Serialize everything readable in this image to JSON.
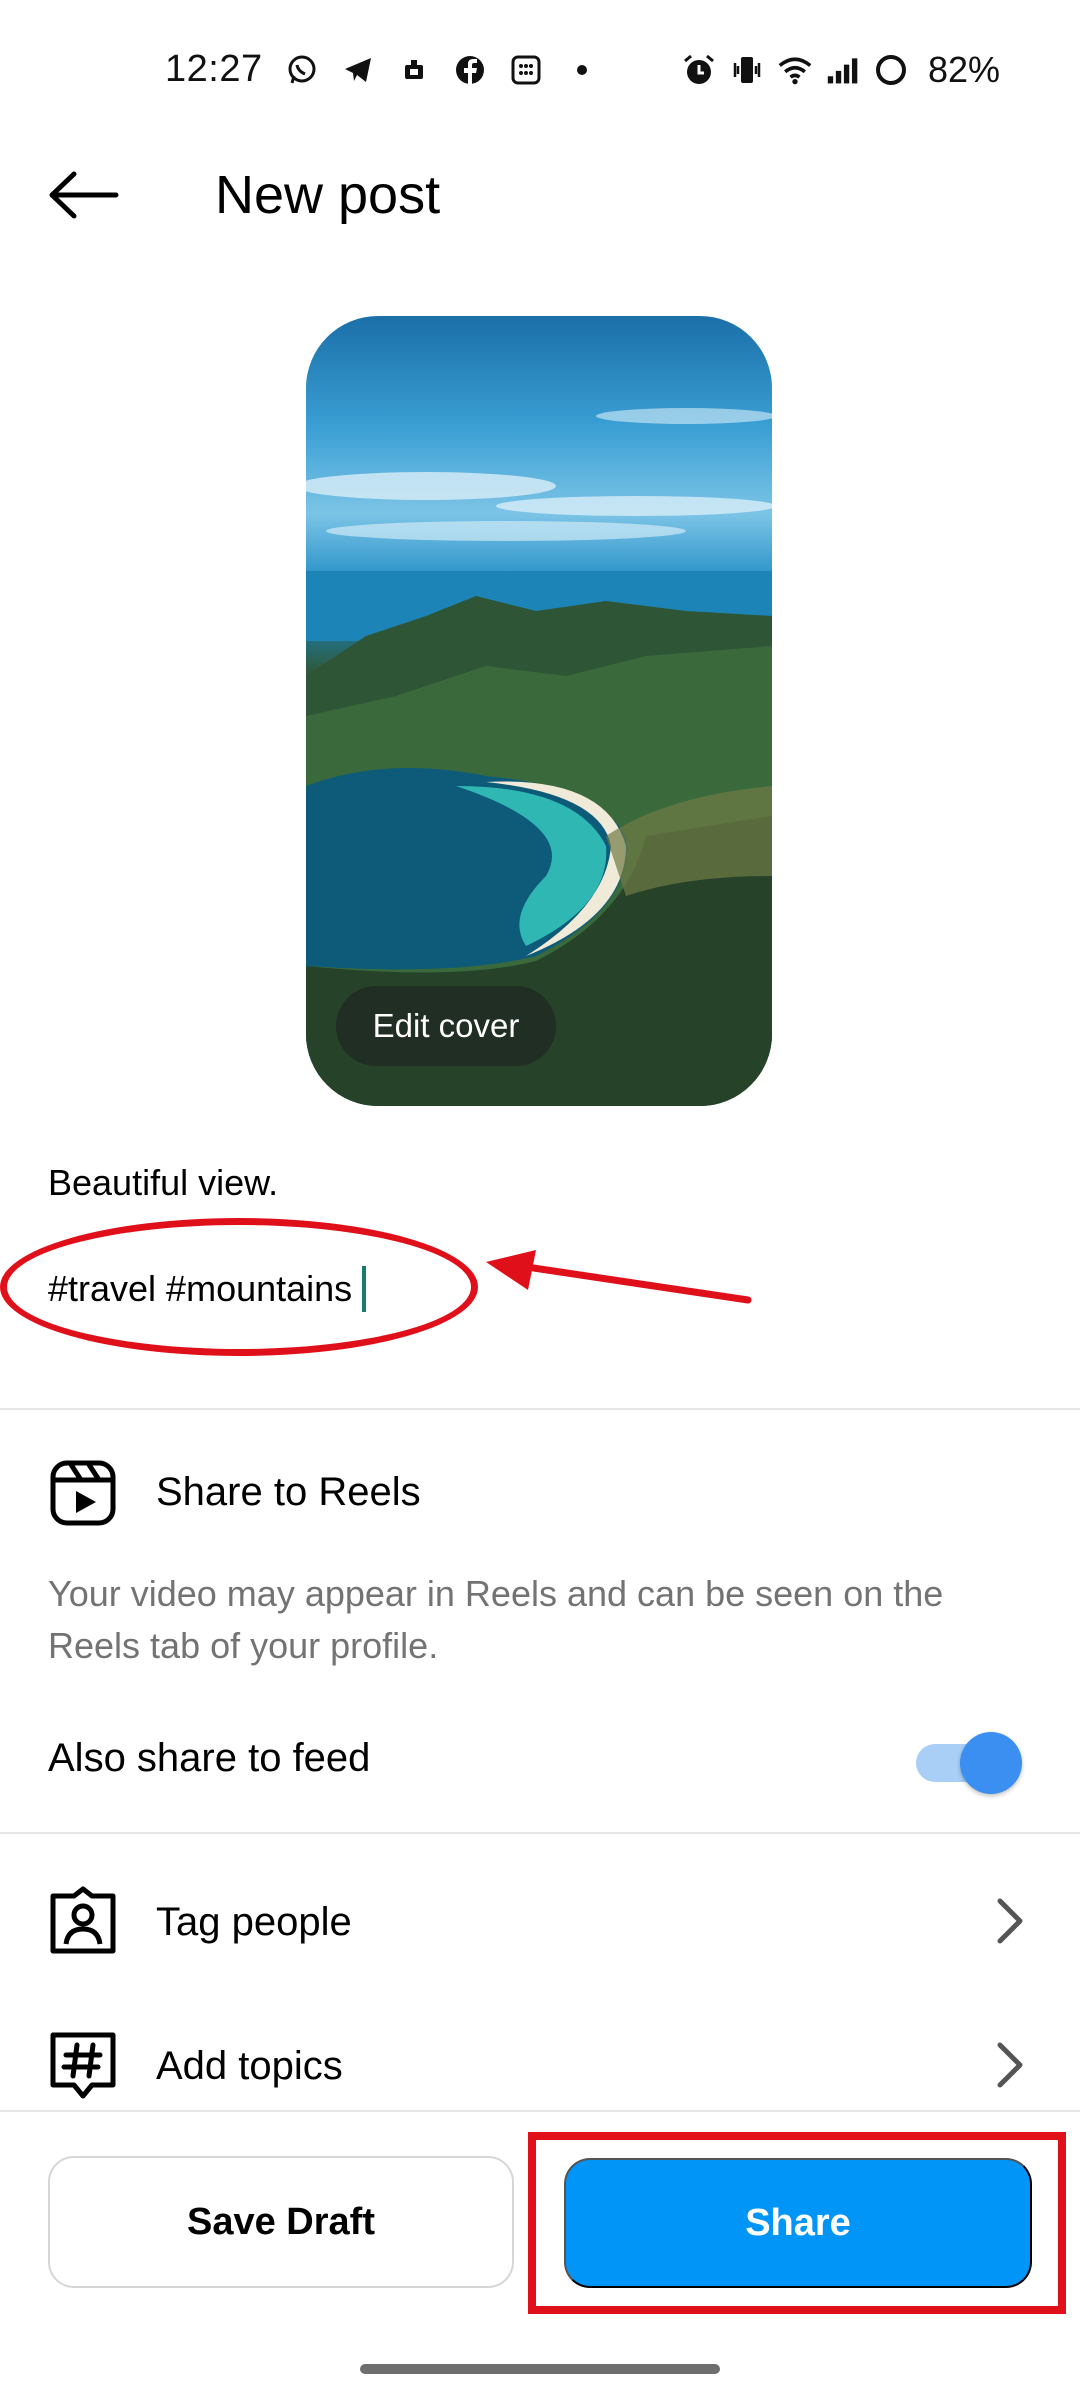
{
  "status_bar": {
    "time": "12:27",
    "battery": "82%",
    "left_icons": [
      "whatsapp-icon",
      "telegram-icon",
      "app-icon",
      "facebook-icon",
      "calendar-icon",
      "dot-icon"
    ],
    "right_icons": [
      "alarm-icon",
      "vibrate-icon",
      "wifi-icon",
      "signal-icon",
      "battery-ring-icon"
    ]
  },
  "header": {
    "title": "New post",
    "back_icon": "arrow-left-icon"
  },
  "cover": {
    "edit_label": "Edit cover"
  },
  "caption": {
    "line1": "Beautiful view.",
    "line2": "#travel #mountains"
  },
  "reels": {
    "title": "Share to Reels",
    "description": "Your video may appear in Reels and can be seen on the Reels tab of your profile.",
    "also_share_label": "Also share to feed",
    "also_share_on": true
  },
  "rows": {
    "tag_people": "Tag people",
    "add_topics": "Add topics"
  },
  "bottom": {
    "save_draft": "Save Draft",
    "share": "Share"
  },
  "colors": {
    "share_button": "#0095f6",
    "annotation": "#e0101a",
    "toggle_knob": "#3a8ff0",
    "toggle_track": "#a9cff7",
    "muted_text": "#737373"
  }
}
